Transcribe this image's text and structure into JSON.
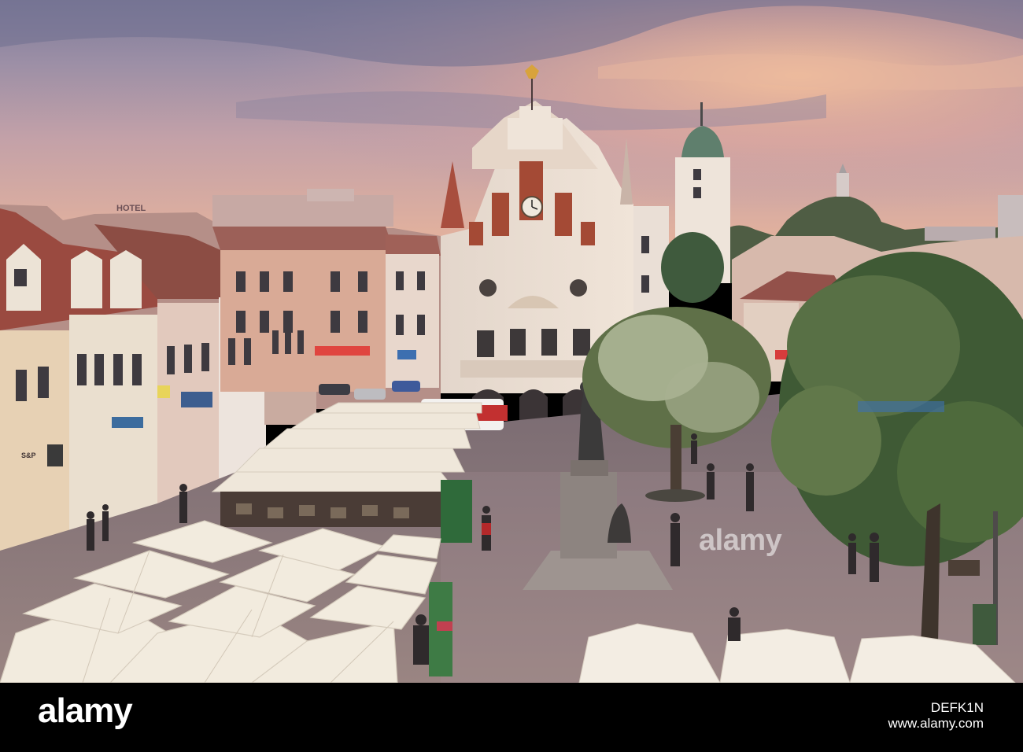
{
  "photo": {
    "description_colors": {
      "sky_top": "#7d7a98",
      "sky_mid": "#b49aa6",
      "sky_glow": "#f0b592",
      "town_hall": "#e9ddd1",
      "roof_red": "#9a4a40",
      "pavement": "#8d7b7e",
      "tree_green": "#5b7045",
      "umbrella": "#f2ebde"
    },
    "signs": {
      "hotel": "HOTEL",
      "shop_left": "S&P"
    }
  },
  "watermark": {
    "text": "alamy"
  },
  "footer": {
    "logo": "alamy",
    "image_id": "DEFK1N",
    "url": "www.alamy.com"
  }
}
